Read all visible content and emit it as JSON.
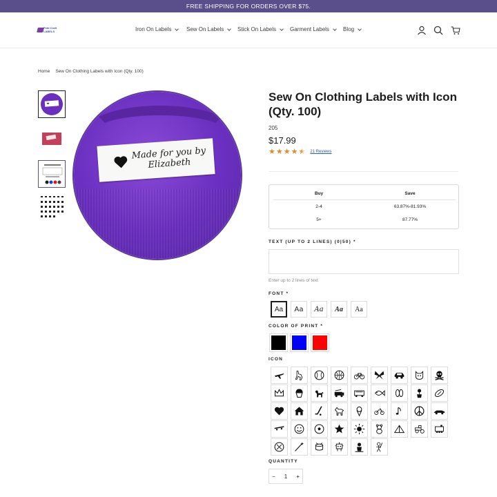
{
  "announcement": "FREE SHIPPING FOR ORDERS OVER $75.",
  "logo": {
    "line1": "Petti Craft",
    "line2": "LABELS"
  },
  "nav": [
    {
      "label": "Iron On Labels"
    },
    {
      "label": "Sew On Labels"
    },
    {
      "label": "Stick On Labels"
    },
    {
      "label": "Garment Labels"
    },
    {
      "label": "Blog"
    }
  ],
  "header_icons": [
    "account-icon",
    "search-icon",
    "cart-icon"
  ],
  "breadcrumb": {
    "home": "Home",
    "current": "Sew On Clothing Labels with Icon (Qty. 100)"
  },
  "product": {
    "title": "Sew On Clothing Labels with Icon (Qty. 100)",
    "sku": "205",
    "price": "$17.99",
    "rating": 4.5,
    "reviews": "21 Reviews",
    "hero_label_text": "Made for you by Elizabeth"
  },
  "tiers": {
    "col_buy": "Buy",
    "col_save": "Save",
    "rows": [
      {
        "buy": "2-4",
        "save": "63.87%-81.93%"
      },
      {
        "buy": "5+",
        "save": "87.77%"
      }
    ]
  },
  "text_field": {
    "label": "TEXT (UP TO 2 LINES) (0|50) *",
    "value": "",
    "hint": "Enter up to 2 lines of text"
  },
  "font": {
    "label": "FONT *",
    "options": [
      "Aa",
      "Aa",
      "Aa",
      "Aa",
      "Aa"
    ],
    "selected": 0
  },
  "color": {
    "label": "COLOR OF PRINT *",
    "options": [
      {
        "name": "black",
        "hex": "#000000"
      },
      {
        "name": "blue",
        "hex": "#0000ff"
      },
      {
        "name": "red",
        "hex": "#ff0000"
      }
    ],
    "selected": 0
  },
  "icon": {
    "label": "ICON",
    "options": [
      "airplane-icon",
      "horse-rider-icon",
      "baseball-icon",
      "basketball-icon",
      "bicycle-icon",
      "butterfly-icon",
      "car-icon",
      "cat-icon",
      "skull-icon",
      "crown-icon",
      "cupcake-icon",
      "dog-icon",
      "fire-truck-icon",
      "bus-icon",
      "fish-icon",
      "flip-flops-icon",
      "flower-pot-icon",
      "football-icon",
      "heart-icon",
      "house-icon",
      "hockey-stick-icon",
      "horse-icon",
      "ice-cream-icon",
      "motorcycle-icon",
      "music-note-icon",
      "peace-icon",
      "race-car-icon",
      "skateboard-icon",
      "smiley-icon",
      "soccer-ball-icon",
      "star-icon",
      "sun-icon",
      "teddy-bear-icon",
      "tent-icon",
      "tractor-icon",
      "train-icon",
      "tennis-ball-icon",
      "wand-icon",
      "drum-icon",
      "robot-icon",
      "sailor-icon",
      "warrior-icon"
    ]
  },
  "quantity": {
    "label": "QUANTITY",
    "value": "1",
    "minus": "−",
    "plus": "+"
  },
  "colors": {
    "brand": "#5a4f8a",
    "star": "#e08a2c",
    "link": "#2a5db0"
  }
}
